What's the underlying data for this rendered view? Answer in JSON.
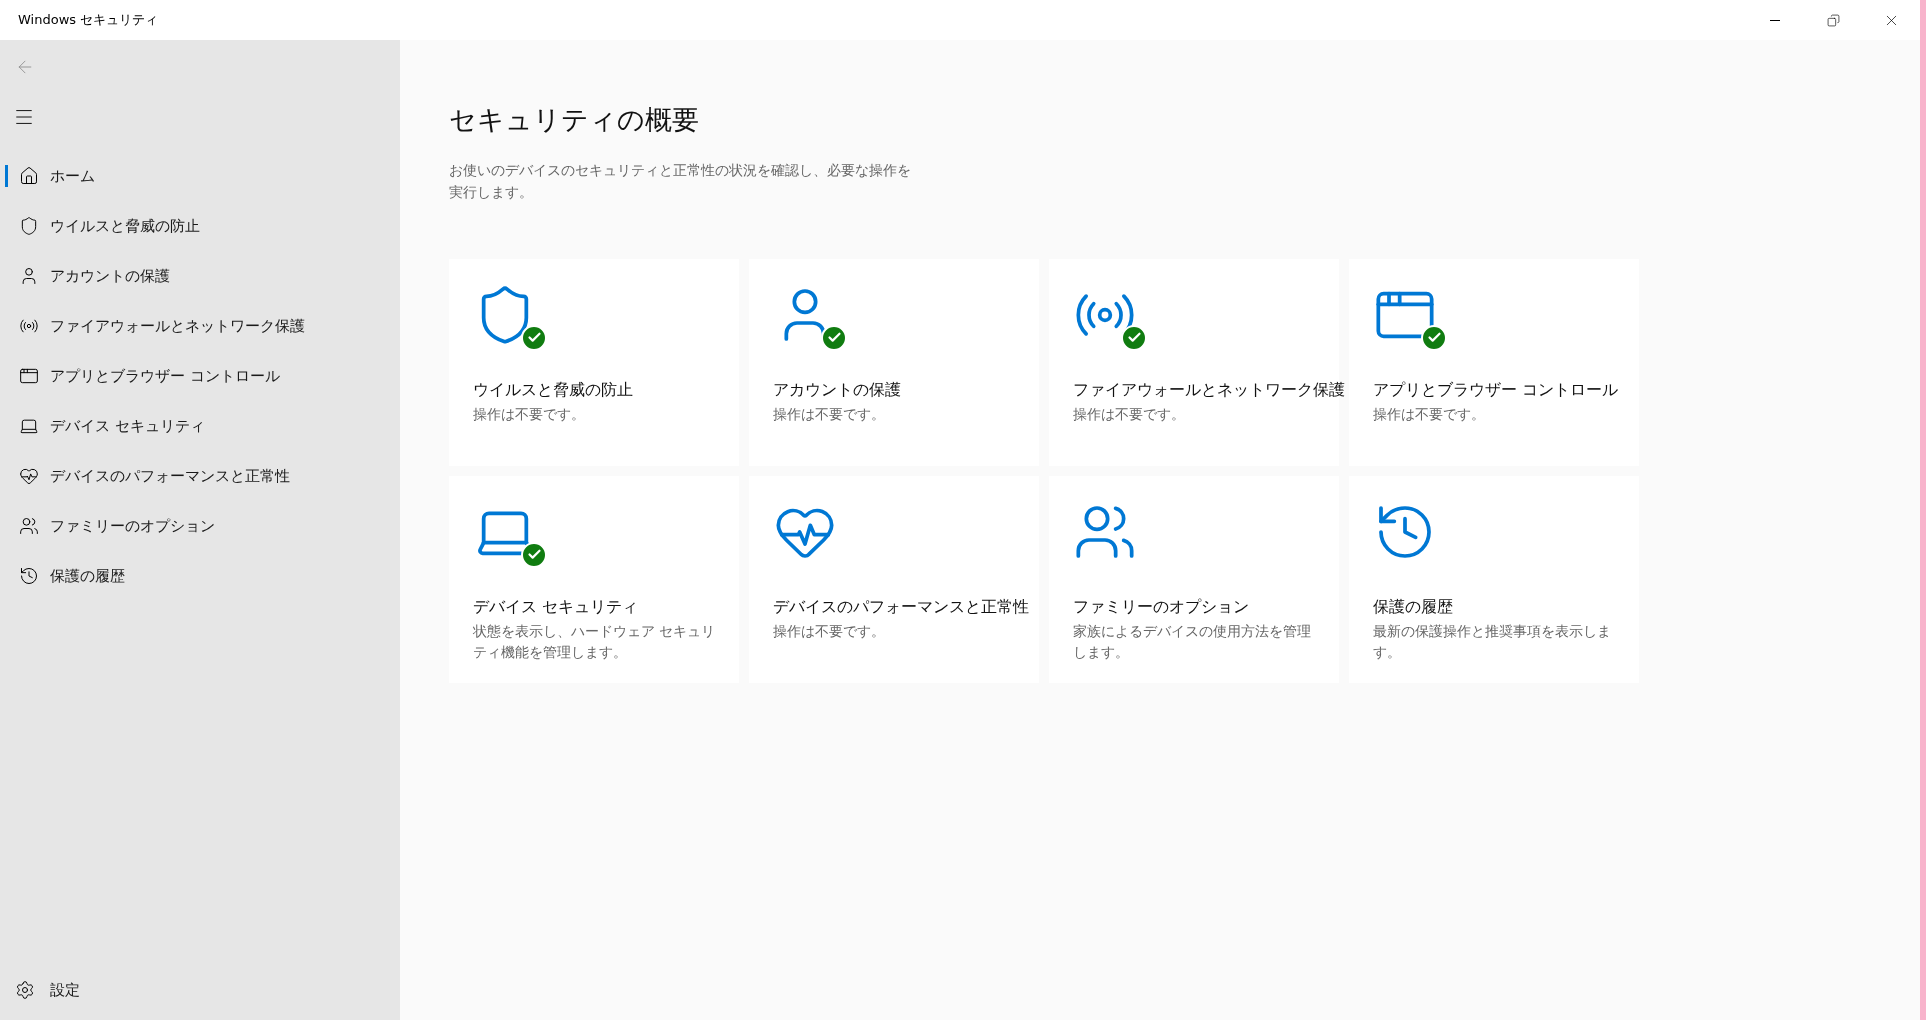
{
  "window": {
    "title": "Windows セキュリティ"
  },
  "sidebar": {
    "items": [
      {
        "label": "ホーム",
        "selected": true
      },
      {
        "label": "ウイルスと脅威の防止",
        "selected": false
      },
      {
        "label": "アカウントの保護",
        "selected": false
      },
      {
        "label": "ファイアウォールとネットワーク保護",
        "selected": false
      },
      {
        "label": "アプリとブラウザー コントロール",
        "selected": false
      },
      {
        "label": "デバイス セキュリティ",
        "selected": false
      },
      {
        "label": "デバイスのパフォーマンスと正常性",
        "selected": false
      },
      {
        "label": "ファミリーのオプション",
        "selected": false
      },
      {
        "label": "保護の履歴",
        "selected": false
      }
    ],
    "settings": "設定"
  },
  "main": {
    "title": "セキュリティの概要",
    "description": "お使いのデバイスのセキュリティと正常性の状況を確認し、必要な操作を実行します。",
    "cards": [
      {
        "title": "ウイルスと脅威の防止",
        "status": "操作は不要です。",
        "ok": true
      },
      {
        "title": "アカウントの保護",
        "status": "操作は不要です。",
        "ok": true
      },
      {
        "title": "ファイアウォールとネットワーク保護",
        "status": "操作は不要です。",
        "ok": true
      },
      {
        "title": "アプリとブラウザー コントロール",
        "status": "操作は不要です。",
        "ok": true
      },
      {
        "title": "デバイス セキュリティ",
        "status": "状態を表示し、ハードウェア セキュリティ機能を管理します。",
        "ok": true
      },
      {
        "title": "デバイスのパフォーマンスと正常性",
        "status": "操作は不要です。",
        "ok": false
      },
      {
        "title": "ファミリーのオプション",
        "status": "家族によるデバイスの使用方法を管理します。",
        "ok": false
      },
      {
        "title": "保護の履歴",
        "status": "最新の保護操作と推奨事項を表示します。",
        "ok": false
      }
    ]
  }
}
